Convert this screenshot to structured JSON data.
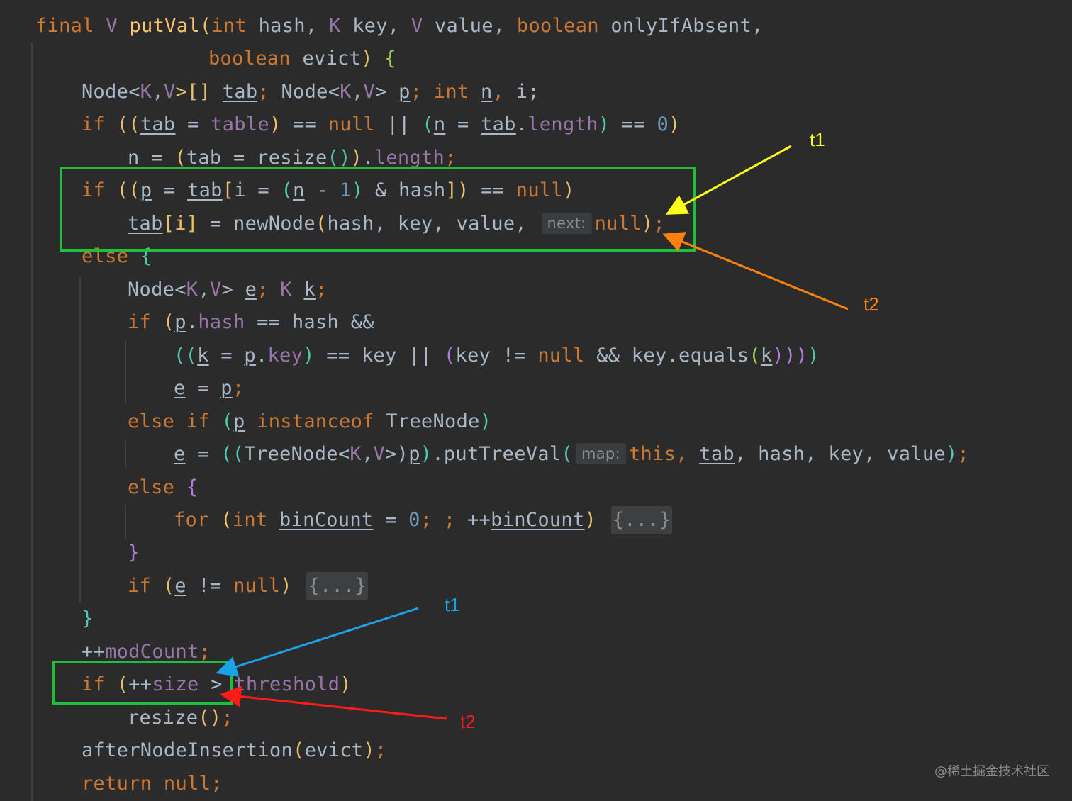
{
  "code": {
    "l1": {
      "kw": "final",
      "t1": "V",
      "name": "putVal",
      "open": "(",
      "int": "int",
      "p1": "hash,",
      "t2": "K",
      "p2": "key,",
      "t3": "V",
      "p3": "value,",
      "bool": "boolean",
      "p4": "onlyIfAbsent,"
    },
    "l2": {
      "bool": "boolean",
      "p": "evict",
      "close": ")",
      "brace": "{"
    },
    "l3": {
      "a": "Node<",
      "k": "K",
      "c": ",",
      "v": "V",
      "b": ">[]",
      "tab": "tab",
      "semi": ";",
      "d": "Node<",
      "k2": "K",
      "c2": ",",
      "v2": "V",
      "e": ">",
      "p": "p",
      "semi2": ";",
      "int": "int",
      "n": "n",
      "c3": ",",
      "i": "i;"
    },
    "l4": {
      "kw": "if",
      "o1": "((",
      "tab": "tab",
      "eq": "=",
      "table": "table",
      "c1": ")",
      "eqeq": "==",
      "null": "null",
      "or": "||",
      "o2": "(",
      "n": "n",
      "eq2": "=",
      "tab2": "tab",
      "dot": ".",
      "len": "length",
      "c2": ")",
      "eqeq2": "==",
      "zero": "0",
      "c3": ")"
    },
    "l5": {
      "n": "n",
      "eq": "=",
      "o1": "(",
      "tab": "tab",
      "eq2": "=",
      "fn": "resize",
      "o2": "(",
      "c2": ")",
      "c1": ")",
      "dot": ".",
      "len": "length",
      "semi": ";"
    },
    "l6": {
      "kw": "if",
      "o1": "((",
      "p": "p",
      "eq": "=",
      "tab": "tab",
      "lb": "[",
      "i": "i",
      "eq2": "=",
      "o2": "(",
      "n": "n",
      "minus": "-",
      "one": "1",
      "c2": ")",
      "amp": "&",
      "hash": "hash",
      "rb": "])",
      "eqeq": "==",
      "null": "null",
      "c1": ")"
    },
    "l7": {
      "tab": "tab",
      "idx": "[i]",
      "eq": "=",
      "fn": "newNode",
      "o": "(",
      "args": "hash, key, value,",
      "hint": "next:",
      "null": "null",
      "c": ")",
      "semi": ";"
    },
    "l8": {
      "kw": "else",
      "brace": "{"
    },
    "l9": {
      "a": "Node<",
      "k": "K",
      "c": ",",
      "v": "V",
      "b": ">",
      "e": "e",
      "semi": ";",
      "k2": "K",
      "kv": "k",
      "semi2": ";"
    },
    "l10": {
      "kw": "if",
      "o": "(",
      "p": "p",
      "dot": ".",
      "hash": "hash",
      "rest": "== hash &&"
    },
    "l11": {
      "o1": "((",
      "k": "k",
      "eq": "=",
      "p": "p",
      "dot": ".",
      "key": "key",
      "c1": ")",
      "rest1": "== key ||",
      "o2": "(",
      "key2": "key !=",
      "null": "null",
      "and": "&& key.equals",
      "o3": "(",
      "k2": "k",
      "c3": ")))",
      "c4": ")"
    },
    "l12": {
      "e": "e",
      "eq": "=",
      "p": "p",
      "semi": ";"
    },
    "l13": {
      "kw": "else if",
      "o": "(",
      "p": "p",
      "kw2": "instanceof",
      "cls": "TreeNode",
      "c": ")"
    },
    "l14": {
      "e": "e",
      "eq": "=",
      "o1": "((",
      "cls": "TreeNode<",
      "k": "K",
      "c": ",",
      "v": "V",
      "b": ">)",
      "p": "p",
      "c1": ")",
      "call": ".putTreeVal",
      "o2": "(",
      "hint": "map:",
      "this": "this",
      "comma": ",",
      "tab": "tab",
      "args": ", hash, key, value",
      "c2": ")",
      "semi": ";"
    },
    "l15": {
      "kw": "else",
      "brace": "{"
    },
    "l16": {
      "kw": "for",
      "o": "(",
      "int": "int",
      "bc": "binCount",
      "eq": "=",
      "zero": "0",
      "semi": "; ;",
      "inc": "++",
      "bc2": "binCount",
      "c": ")",
      "fold": "{...}"
    },
    "l17": {
      "brace": "}"
    },
    "l18": {
      "kw": "if",
      "o": "(",
      "e": "e",
      "ne": "!=",
      "null": "null",
      "c": ")",
      "fold": "{...}"
    },
    "l19": {
      "brace": "}"
    },
    "l20": {
      "inc": "++",
      "mc": "modCount",
      "semi": ";"
    },
    "l21": {
      "kw": "if",
      "o": "(",
      "inc": "++",
      "size": "size",
      "gt": ">",
      "th": "threshold",
      "c": ")"
    },
    "l22": {
      "fn": "resize",
      "o": "(",
      "c": ")",
      "semi": ";"
    },
    "l23": {
      "fn": "afterNodeInsertion",
      "o": "(",
      "arg": "evict",
      "c": ")",
      "semi": ";"
    },
    "l24": {
      "kw": "return",
      "null": "null",
      "semi": ";"
    }
  },
  "annotations": {
    "t1_top": "t1",
    "t2_top": "t2",
    "t1_bottom": "t1",
    "t2_bottom": "t2",
    "colors": {
      "box": "#1fbf3a",
      "t1_top": "#ffff1a",
      "t2_top": "#ff7f0f",
      "t1_bottom": "#1aa3e8",
      "t2_bottom": "#ff1a1a"
    }
  },
  "watermark": "@稀土掘金技术社区"
}
